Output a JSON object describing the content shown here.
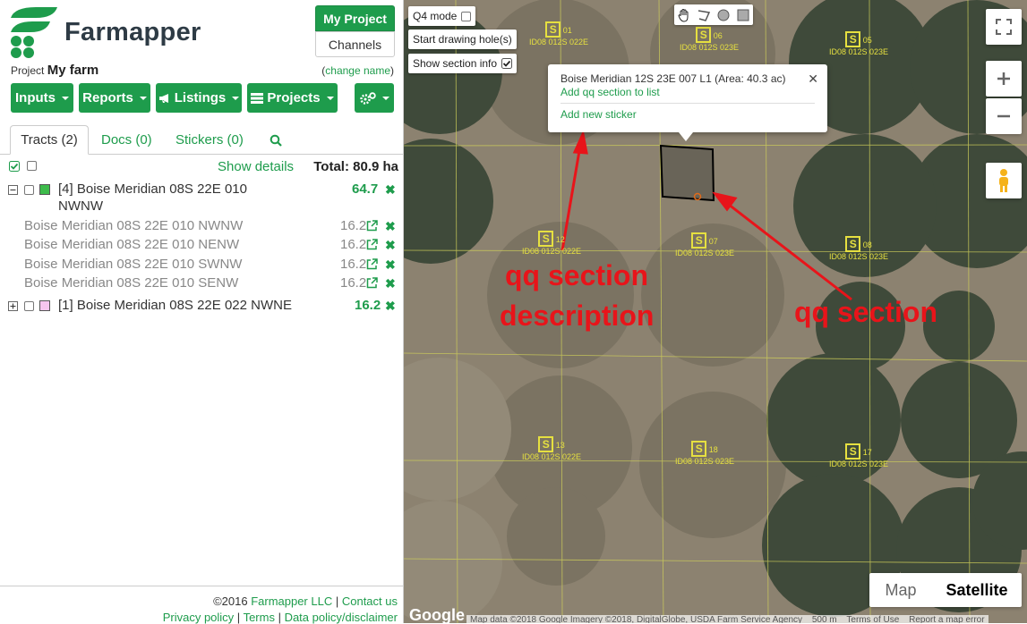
{
  "header": {
    "brand": "Farmapper",
    "my_project_label": "My Project",
    "channels_label": "Channels",
    "project_prefix": "Project",
    "project_name": "My farm",
    "change_name": "change name"
  },
  "toolbar": {
    "inputs": "Inputs",
    "reports": "Reports",
    "listings": "Listings",
    "projects": "Projects"
  },
  "tabs": {
    "tracts": "Tracts (2)",
    "docs": "Docs (0)",
    "stickers": "Stickers (0)"
  },
  "list": {
    "show_details": "Show details",
    "total": "Total: 80.9 ha",
    "tract1": {
      "label_line1": "[4] Boise Meridian 08S 22E 010",
      "label_line2": "NWNW",
      "area": "64.7",
      "color": "#3dbb4b"
    },
    "subs": [
      {
        "label": "Boise Meridian 08S 22E 010 NWNW",
        "area": "16.2"
      },
      {
        "label": "Boise Meridian 08S 22E 010 NENW",
        "area": "16.2"
      },
      {
        "label": "Boise Meridian 08S 22E 010 SWNW",
        "area": "16.2"
      },
      {
        "label": "Boise Meridian 08S 22E 010 SENW",
        "area": "16.2"
      }
    ],
    "tract2": {
      "label": "[1] Boise Meridian 08S 22E 022 NWNE",
      "area": "16.2",
      "color": "#ee5fd6"
    }
  },
  "footer": {
    "copyright": "©2016",
    "company": "Farmapper LLC",
    "contact": "Contact us",
    "privacy": "Privacy policy",
    "terms": "Terms",
    "data_policy": "Data policy/disclaimer"
  },
  "map": {
    "q4_mode": "Q4 mode",
    "start_hole": "Start drawing hole(s)",
    "show_section": "Show section info",
    "popup_title": "Boise Meridian 12S 23E 007 L1 (Area: 40.3 ac)",
    "popup_add_qq": "Add qq section to list",
    "popup_add_sticker": "Add new sticker",
    "annot_desc_1": "qq section",
    "annot_desc_2": "description",
    "annot_qq": "qq section",
    "map_btn": "Map",
    "satellite_btn": "Satellite",
    "google": "Google",
    "attribution": "Map data ©2018 Google Imagery ©2018, DigitalGlobe, USDA Farm Service Agency",
    "scale": "500 m",
    "terms_of_use": "Terms of Use",
    "report_error": "Report a map error",
    "sections": [
      {
        "num": "01",
        "code": "ID08 012S 022E"
      },
      {
        "num": "06",
        "code": "ID08 012S 023E"
      },
      {
        "num": "05",
        "code": "ID08 012S 023E"
      },
      {
        "num": "12",
        "code": "ID08 012S 022E"
      },
      {
        "num": "07",
        "code": "ID08 012S 023E"
      },
      {
        "num": "08",
        "code": "ID08 012S 023E"
      },
      {
        "num": "13",
        "code": "ID08 012S 022E"
      },
      {
        "num": "18",
        "code": "ID08 012S 023E"
      },
      {
        "num": "17",
        "code": "ID08 012S 023E"
      }
    ]
  }
}
